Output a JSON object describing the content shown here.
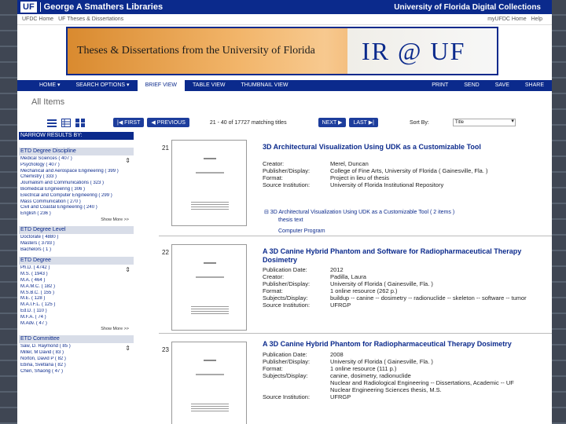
{
  "header": {
    "logo": "UF",
    "library": "George A Smathers Libraries",
    "collections": "University of Florida Digital Collections"
  },
  "subnav": {
    "left": [
      "UFDC Home",
      "UF Theses & Dissertations"
    ],
    "right": [
      "myUFDC Home",
      "Help"
    ]
  },
  "banner": {
    "left_text": "Theses & Dissertations from the University of Florida",
    "right_text": "IR @ UF"
  },
  "mainnav": {
    "items": [
      "HOME ▾",
      "SEARCH OPTIONS ▾",
      "BRIEF VIEW",
      "TABLE VIEW",
      "THUMBNAIL VIEW"
    ],
    "right": [
      "PRINT",
      "SEND",
      "SAVE",
      "SHARE"
    ]
  },
  "page_title": "All Items",
  "toolbar": {
    "first": "|◀ FIRST",
    "previous": "◀ PREVIOUS",
    "results": "21 - 40 of 17727 matching titles",
    "next": "NEXT ▶",
    "last": "LAST ▶|",
    "sort_label": "Sort By:",
    "sort_value": "Title"
  },
  "narrow": {
    "heading": "NARROW RESULTS BY:",
    "facets": [
      {
        "title": "ETD Degree Discipline",
        "items": [
          "Medical Sciences ( 407 )",
          "Psychology ( 407 )",
          "Mechanical and Aerospace Engineering ( 399 )",
          "Chemistry ( 333 )",
          "Journalism and Communications ( 323 )",
          "Biomedical Engineering ( 306 )",
          "Electrical and Computer Engineering ( 299 )",
          "Mass Communication ( 270 )",
          "Civil and Coastal Engineering ( 240 )",
          "English ( 236 )"
        ],
        "more": "Show More >>"
      },
      {
        "title": "ETD Degree Level",
        "items": [
          "Doctorate ( 4880 )",
          "Masters ( 3793 )",
          "Bachelors ( 1 )"
        ]
      },
      {
        "title": "ETD Degree",
        "items": [
          "Ph.D. ( 4742 )",
          "M.S. ( 1943 )",
          "M.A. ( 464 )",
          "M.A.M.C. ( 182 )",
          "M.S.B.C. ( 155 )",
          "M.E. ( 128 )",
          "M.A.I.F.L. ( 125 )",
          "Ed.D. ( 110 )",
          "M.F.A. ( 74 )",
          "M.Adv. ( 47 )"
        ],
        "more": "Show More >>"
      },
      {
        "title": "ETD Committee",
        "items": [
          "Saw, D. Raymond ( 85 )",
          "Miller, M David ( 83 )",
          "Norton, David P ( 82 )",
          "Ebina, Svetlana ( 82 )",
          "Chen, Shaong ( 47 )"
        ]
      }
    ]
  },
  "results": [
    {
      "num": "21",
      "title": "3D Architectural Visualization Using UDK as a Customizable Tool",
      "meta": [
        [
          "Creator:",
          "Merel, Duncan"
        ],
        [
          "Publisher/Display:",
          "College of Fine Arts, University of Florida ( Gainesville, Fla. )"
        ],
        [
          "Format:",
          "Project in lieu of thesis"
        ],
        [
          "Source Institution:",
          "University of Florida Institutional Repository"
        ]
      ],
      "sub": {
        "title": "⊟ 3D Architectural Visualization Using UDK as a Customizable Tool ( 2 items )",
        "links": [
          "thesis text",
          "Computer Program"
        ]
      }
    },
    {
      "num": "22",
      "title": "A 3D Canine Hybrid Phantom and Software for Radiopharmaceutical Therapy Dosimetry",
      "meta": [
        [
          "Publication Date:",
          "2012"
        ],
        [
          "Creator:",
          "Padilla, Laura"
        ],
        [
          "Publisher/Display:",
          "University of Florida ( Gainesville, Fla. )"
        ],
        [
          "Format:",
          "1 online resource (262 p.)"
        ],
        [
          "Subjects/Display:",
          "buildup -- canine -- dosimetry -- radionuclide -- skeleton -- software -- tumor"
        ],
        [
          "Source Institution:",
          "UFRGP"
        ]
      ]
    },
    {
      "num": "23",
      "title": "A 3D Canine Hybrid Phantom for Radiopharmaceutical Therapy Dosimetry",
      "meta": [
        [
          "Publication Date:",
          "2008"
        ],
        [
          "Publisher/Display:",
          "University of Florida ( Gainesville, Fla. )"
        ],
        [
          "Format:",
          "1 online resource (111 p.)"
        ],
        [
          "Subjects/Display:",
          "canine, dosimetry, radionuclide"
        ],
        [
          "",
          "Nuclear and Radiological Engineering -- Dissertations, Academic -- UF"
        ],
        [
          "",
          "Nuclear Engineering Sciences thesis, M.S."
        ],
        [
          "Source Institution:",
          "UFRGP"
        ]
      ]
    }
  ]
}
